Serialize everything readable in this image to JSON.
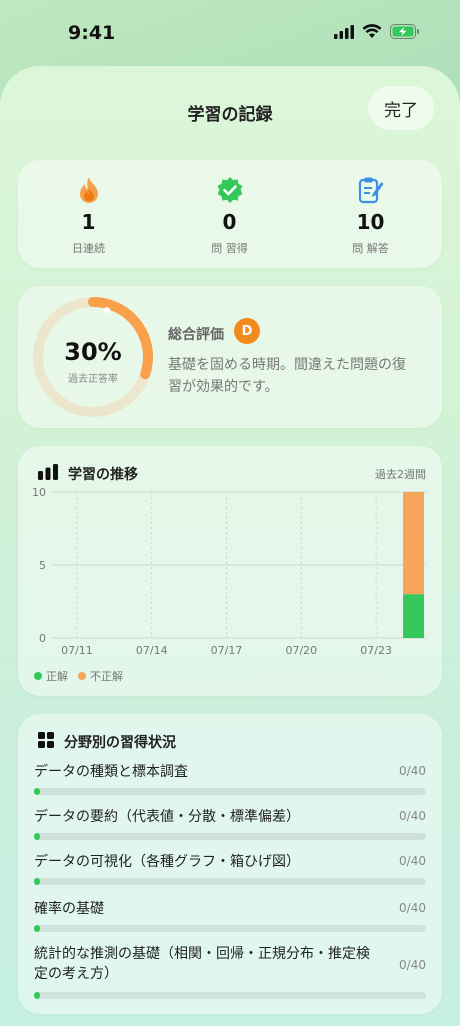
{
  "status": {
    "time": "9:41"
  },
  "header": {
    "title": "学習の記録",
    "done_label": "完了"
  },
  "stats": [
    {
      "icon": "flame-icon",
      "value": "1",
      "label": "日連続"
    },
    {
      "icon": "check-badge-icon",
      "value": "0",
      "label": "問 習得"
    },
    {
      "icon": "clipboard-icon",
      "value": "10",
      "label": "問 解答"
    }
  ],
  "summary": {
    "percent_text": "30%",
    "percent_value": 30,
    "percent_label": "過去正答率",
    "eval_title": "総合評価",
    "grade": "D",
    "description": "基礎を固める時期。間違えた問題の復習が効果的です。"
  },
  "trend": {
    "title": "学習の推移",
    "period": "過去2週間",
    "legend": {
      "correct": "正解",
      "incorrect": "不正解"
    }
  },
  "chart_data": {
    "type": "bar",
    "title": "学習の推移",
    "x_ticks": [
      "07/11",
      "07/14",
      "07/17",
      "07/20",
      "07/23"
    ],
    "y_ticks": [
      "0",
      "5",
      "10"
    ],
    "ylim": [
      0,
      10
    ],
    "categories": [
      "07/10",
      "07/11",
      "07/12",
      "07/13",
      "07/14",
      "07/15",
      "07/16",
      "07/17",
      "07/18",
      "07/19",
      "07/20",
      "07/21",
      "07/22",
      "07/23",
      "07/24"
    ],
    "series": [
      {
        "name": "正解",
        "color": "#34c759",
        "values": [
          0,
          0,
          0,
          0,
          0,
          0,
          0,
          0,
          0,
          0,
          0,
          0,
          0,
          0,
          3
        ]
      },
      {
        "name": "不正解",
        "color": "#f6a55b",
        "values": [
          0,
          0,
          0,
          0,
          0,
          0,
          0,
          0,
          0,
          0,
          0,
          0,
          0,
          0,
          7
        ]
      }
    ],
    "grid": true
  },
  "subjects": {
    "title": "分野別の習得状況",
    "items": [
      {
        "name": "データの種類と標本調査",
        "count": "0/40",
        "progress": 0
      },
      {
        "name": "データの要約（代表値・分散・標準偏差）",
        "count": "0/40",
        "progress": 0
      },
      {
        "name": "データの可視化（各種グラフ・箱ひげ図）",
        "count": "0/40",
        "progress": 0
      },
      {
        "name": "確率の基礎",
        "count": "0/40",
        "progress": 0
      },
      {
        "name": "統計的な推測の基礎（相関・回帰・正規分布・推定検定の考え方）",
        "count": "0/40",
        "progress": 0
      }
    ]
  },
  "colors": {
    "accent_orange": "#f28a1e",
    "correct_green": "#34c759",
    "incorrect_orange": "#f6a55b"
  }
}
